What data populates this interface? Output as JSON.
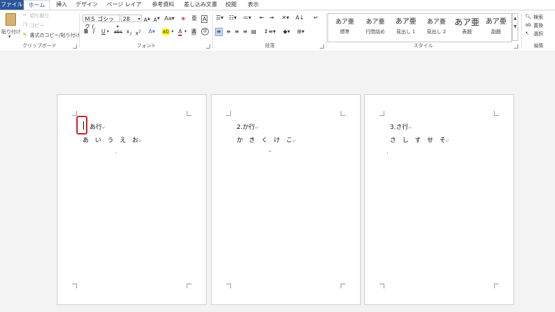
{
  "tabs": [
    {
      "label": "ファイル"
    },
    {
      "label": "ホーム"
    },
    {
      "label": "挿入"
    },
    {
      "label": "デザイン"
    },
    {
      "label": "ページ レイアウト"
    },
    {
      "label": "参考資料"
    },
    {
      "label": "差し込み文書"
    },
    {
      "label": "校閲"
    },
    {
      "label": "表示"
    }
  ],
  "clipboard": {
    "paste": "貼り付け",
    "cut": "切り取り",
    "copy": "コピー",
    "format_painter": "書式のコピー/貼り付け",
    "group": "クリップボード"
  },
  "font": {
    "name": "ＭＳ ゴシック (.",
    "size": "28",
    "group": "フォント"
  },
  "paragraph": {
    "group": "段落"
  },
  "styles": {
    "items": [
      {
        "sample": "あア亜",
        "name": "標準"
      },
      {
        "sample": "あア亜",
        "name": "行間詰め"
      },
      {
        "sample": "あア亜",
        "name": "見出し 1"
      },
      {
        "sample": "あア亜",
        "name": "見出し 2"
      },
      {
        "sample": "あア亜",
        "name": "表題"
      },
      {
        "sample": "あア亜",
        "name": "副題"
      }
    ],
    "group": "スタイル"
  },
  "editing": {
    "find": "検索",
    "replace": "置換",
    "select": "選択",
    "group": "編集"
  },
  "pages": [
    {
      "heading": "あ行",
      "row": "あ い う え お"
    },
    {
      "heading": "2.か行",
      "row": "か き く け こ"
    },
    {
      "heading": "3.さ行",
      "row": "さ し す せ そ"
    }
  ],
  "colors": {
    "file_tab": "#2b579a",
    "highlight_box": "#d21f1f"
  }
}
